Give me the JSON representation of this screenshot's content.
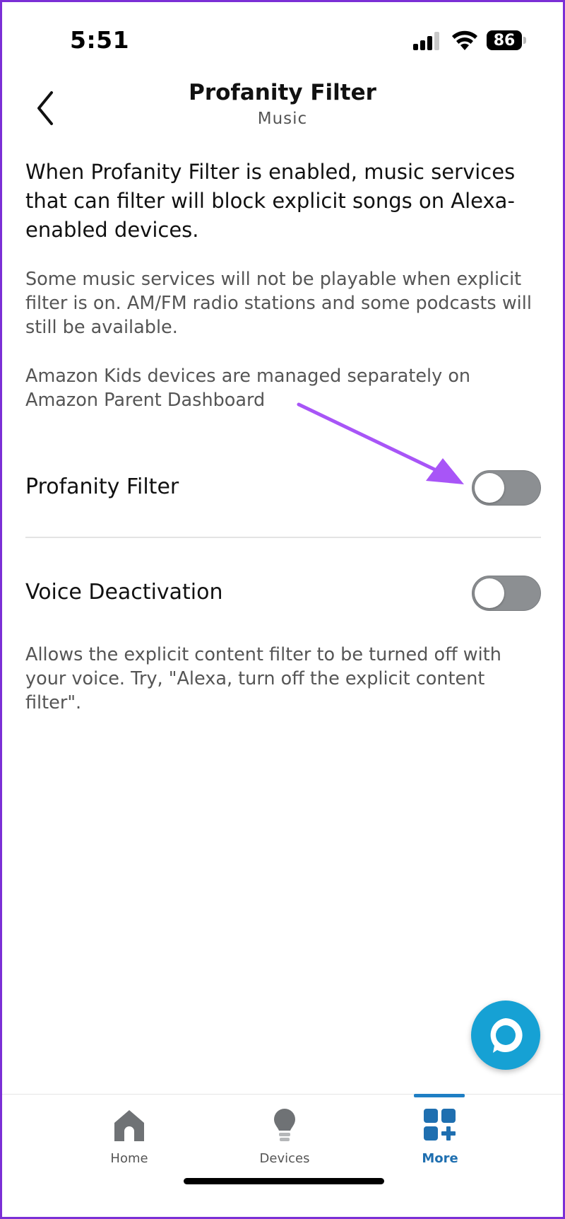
{
  "status_bar": {
    "time": "5:51",
    "battery": "86"
  },
  "header": {
    "title": "Profanity Filter",
    "subtitle": "Music"
  },
  "content": {
    "intro": "When Profanity Filter is enabled, music services that can filter will block explicit songs on Alexa-enabled devices.",
    "note": "Some music services will not be playable when explicit filter is on. AM/FM radio stations and some podcasts will still be available.",
    "kids_note": "Amazon Kids devices are managed separately on Amazon Parent Dashboard"
  },
  "settings": [
    {
      "label": "Profanity Filter",
      "enabled": false
    },
    {
      "label": "Voice Deactivation",
      "enabled": false
    }
  ],
  "voice_help": "Allows the explicit content filter to be turned off with your voice. Try, \"Alexa, turn off the explicit content filter\".",
  "tabs": [
    {
      "label": "Home",
      "icon": "home-icon",
      "active": false
    },
    {
      "label": "Devices",
      "icon": "lightbulb-icon",
      "active": false
    },
    {
      "label": "More",
      "icon": "more-grid-icon",
      "active": true
    }
  ],
  "colors": {
    "accent": "#1f7fc4",
    "alexa_button": "#16a1d4",
    "annotation_arrow": "#a855f7",
    "toggle_off": "#8c8f92"
  }
}
